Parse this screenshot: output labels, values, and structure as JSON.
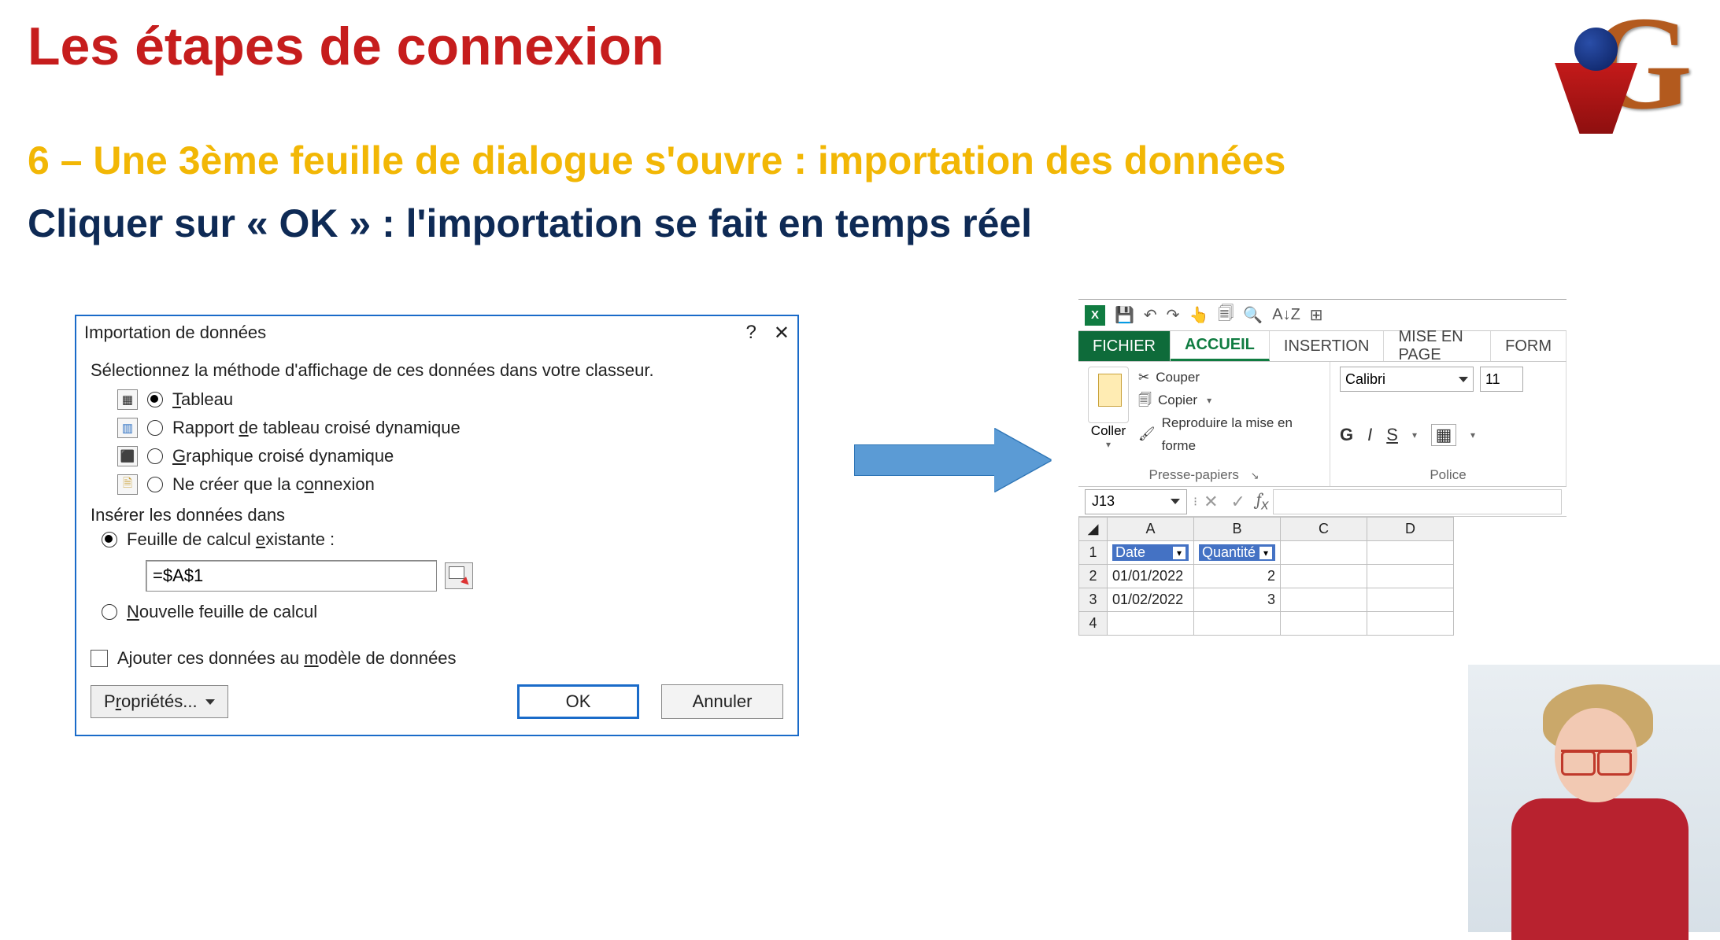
{
  "slide": {
    "title": "Les étapes de connexion",
    "sub1": "6 – Une 3ème feuille de dialogue s'ouvre : importation des données",
    "sub2": "Cliquer sur « OK » : l'importation se fait en temps réel"
  },
  "dialog": {
    "title": "Importation de données",
    "help_glyph": "?",
    "close_glyph": "✕",
    "intro": "Sélectionnez la méthode d'affichage de ces données dans votre classeur.",
    "opts": {
      "table": "Tableau",
      "pivot": "Rapport de tableau croisé dynamique",
      "chart": "Graphique croisé dynamique",
      "conn": "Ne créer que la connexion"
    },
    "insert_label": "Insérer les données dans",
    "existing": "Feuille de calcul existante :",
    "cellref": "=$A$1",
    "newsheet": "Nouvelle feuille de calcul",
    "model": "Ajouter ces données au modèle de données",
    "props": "Propriétés...",
    "ok": "OK",
    "cancel": "Annuler"
  },
  "excel": {
    "tabs": {
      "file": "FICHIER",
      "home": "ACCUEIL",
      "insert": "INSERTION",
      "layout": "MISE EN PAGE",
      "form": "FORM"
    },
    "clip": {
      "paste": "Coller",
      "cut": "Couper",
      "copy": "Copier",
      "fmtpaint": "Reproduire la mise en forme",
      "group": "Presse-papiers"
    },
    "font": {
      "name": "Calibri",
      "size": "11",
      "group": "Police"
    },
    "biu": {
      "b": "G",
      "i": "I",
      "u": "S"
    },
    "namebox": "J13",
    "qat_glyphs": {
      "save": "💾",
      "undo": "↶",
      "redo": "↷",
      "touch": "👆",
      "printprev": "🗐",
      "preview": "🔍",
      "sort": "A↓Z",
      "form": "⊞"
    },
    "headers": [
      "A",
      "B",
      "C",
      "D"
    ],
    "table": {
      "h1": "Date",
      "h2": "Quantité",
      "rows": [
        {
          "n": "1"
        },
        {
          "n": "2",
          "a": "01/01/2022",
          "b": "2"
        },
        {
          "n": "3",
          "a": "01/02/2022",
          "b": "3"
        },
        {
          "n": "4"
        }
      ]
    }
  }
}
